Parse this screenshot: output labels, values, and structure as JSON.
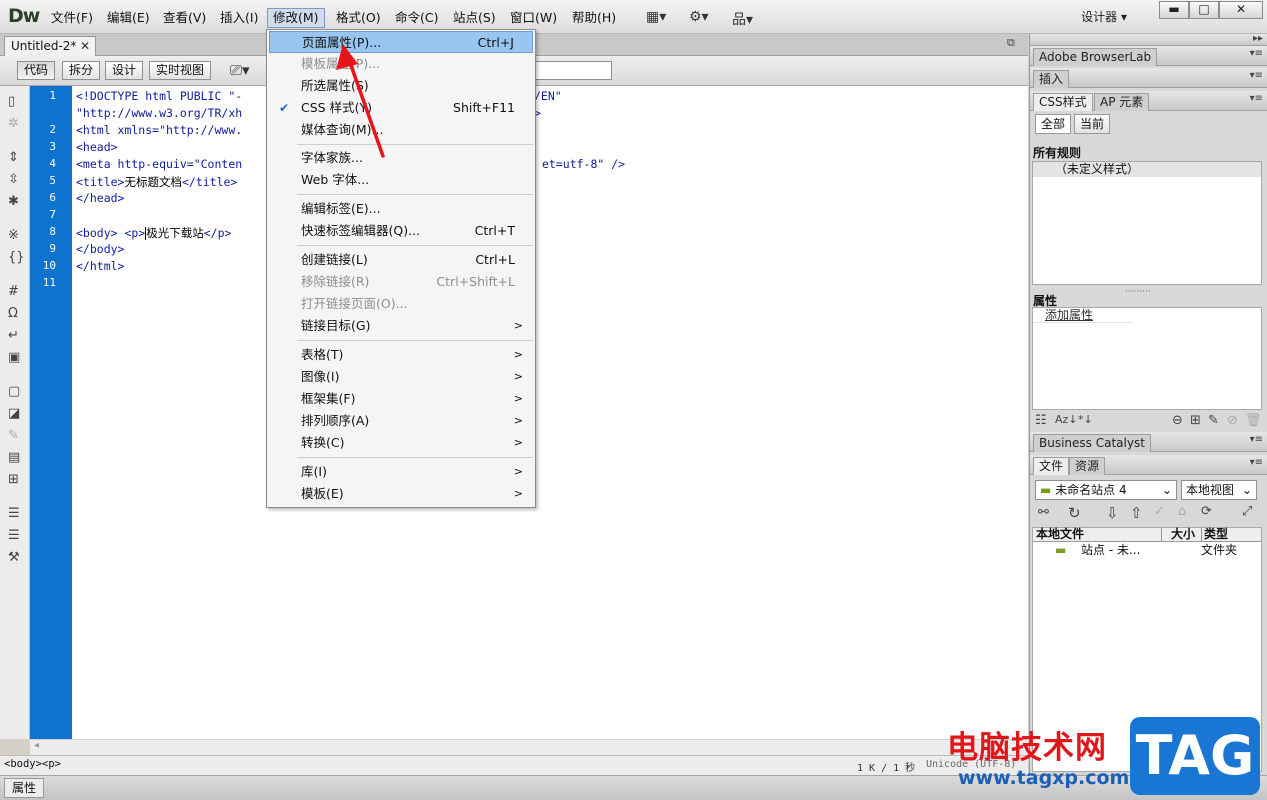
{
  "app": {
    "logo": "Dw",
    "workspace": "设计器"
  },
  "menubar": {
    "items": [
      "文件(F)",
      "编辑(E)",
      "查看(V)",
      "插入(I)",
      "修改(M)",
      "格式(O)",
      "命令(C)",
      "站点(S)",
      "窗口(W)",
      "帮助(H)"
    ]
  },
  "document": {
    "tab_title": "Untitled-2*"
  },
  "view_buttons": [
    "代码",
    "拆分",
    "设计",
    "实时视图"
  ],
  "code": {
    "line_numbers": [
      "1",
      "",
      "2",
      "3",
      "4",
      "5",
      "6",
      "7",
      "8",
      "9",
      "10",
      "11"
    ],
    "lines": [
      "<!DOCTYPE html PUBLIC \"-",
      "\"http://www.w3.org/TR/xh",
      "<html xmlns=\"http://www.",
      "<head>",
      "<meta http-equiv=\"Conten",
      "<title>",
      "</head>",
      "",
      "<body> <p>",
      "</body>",
      "</html>",
      ""
    ],
    "right_fragments": {
      "line1": "/EN\"",
      "line1b": ">",
      "line4": "et=utf-8\" />"
    },
    "title_text": "无标题文档",
    "title_close": "</title>",
    "p_text": "极光下载站",
    "p_close": "</p>"
  },
  "status": {
    "tag_path": "<body><p>",
    "size": "1 K / 1 秒",
    "encoding": "Unicode (UTF-8)"
  },
  "properties_tab": "属性",
  "dropdown": {
    "items": [
      {
        "label": "页面属性(P)...",
        "shortcut": "Ctrl+J",
        "highlight": true
      },
      {
        "label": "模板属性(P)...",
        "disabled": true
      },
      {
        "label": "所选属性(S)"
      },
      {
        "label": "CSS 样式(Y)",
        "shortcut": "Shift+F11",
        "checked": true
      },
      {
        "label": "媒体查询(M)..."
      },
      {
        "label": "字体家族..."
      },
      {
        "label": "Web 字体..."
      },
      {
        "label": "编辑标签(E)..."
      },
      {
        "label": "快速标签编辑器(Q)...",
        "shortcut": "Ctrl+T"
      },
      {
        "label": "创建链接(L)",
        "shortcut": "Ctrl+L"
      },
      {
        "label": "移除链接(R)",
        "shortcut": "Ctrl+Shift+L",
        "disabled": true
      },
      {
        "label": "打开链接页面(O)...",
        "disabled": true
      },
      {
        "label": "链接目标(G)",
        "submenu": true
      },
      {
        "label": "表格(T)",
        "submenu": true
      },
      {
        "label": "图像(I)",
        "submenu": true
      },
      {
        "label": "框架集(F)",
        "submenu": true
      },
      {
        "label": "排列顺序(A)",
        "submenu": true
      },
      {
        "label": "转换(C)",
        "submenu": true
      },
      {
        "label": "库(I)",
        "submenu": true
      },
      {
        "label": "模板(E)",
        "submenu": true
      }
    ]
  },
  "right_panel": {
    "browserlab": "Adobe BrowserLab",
    "insert": "插入",
    "css_tabs": [
      "CSS样式",
      "AP 元素"
    ],
    "css_modes": [
      "全部",
      "当前"
    ],
    "all_rules_title": "所有规则",
    "no_styles": "（未定义样式）",
    "props_title": "属性",
    "add_property": "添加属性",
    "business_catalyst": "Business Catalyst",
    "files_tabs": [
      "文件",
      "资源"
    ],
    "site_select": "未命名站点 4",
    "view_select": "本地视图",
    "columns": [
      "本地文件",
      "大小",
      "类型"
    ],
    "site_row": {
      "name": "站点 - 未...",
      "type": "文件夹"
    }
  },
  "watermark": {
    "text": "电脑技术网",
    "url": "www.tagxp.com",
    "badge": "TAG"
  },
  "colors": {
    "gutter": "#0e72cf",
    "menu_highlight": "#99c6f0",
    "arrow": "#e8141b"
  }
}
